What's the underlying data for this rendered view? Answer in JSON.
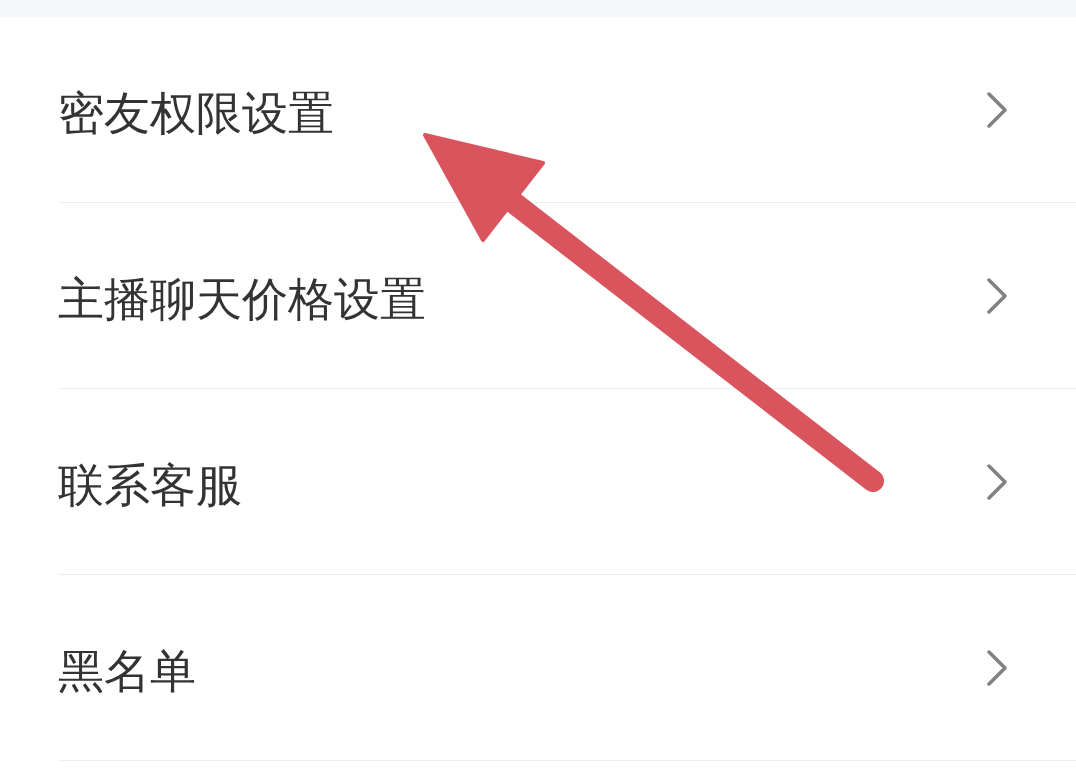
{
  "settings_list": [
    {
      "label": "密友权限设置"
    },
    {
      "label": "主播聊天价格设置"
    },
    {
      "label": "联系客服"
    },
    {
      "label": "黑名单"
    }
  ]
}
